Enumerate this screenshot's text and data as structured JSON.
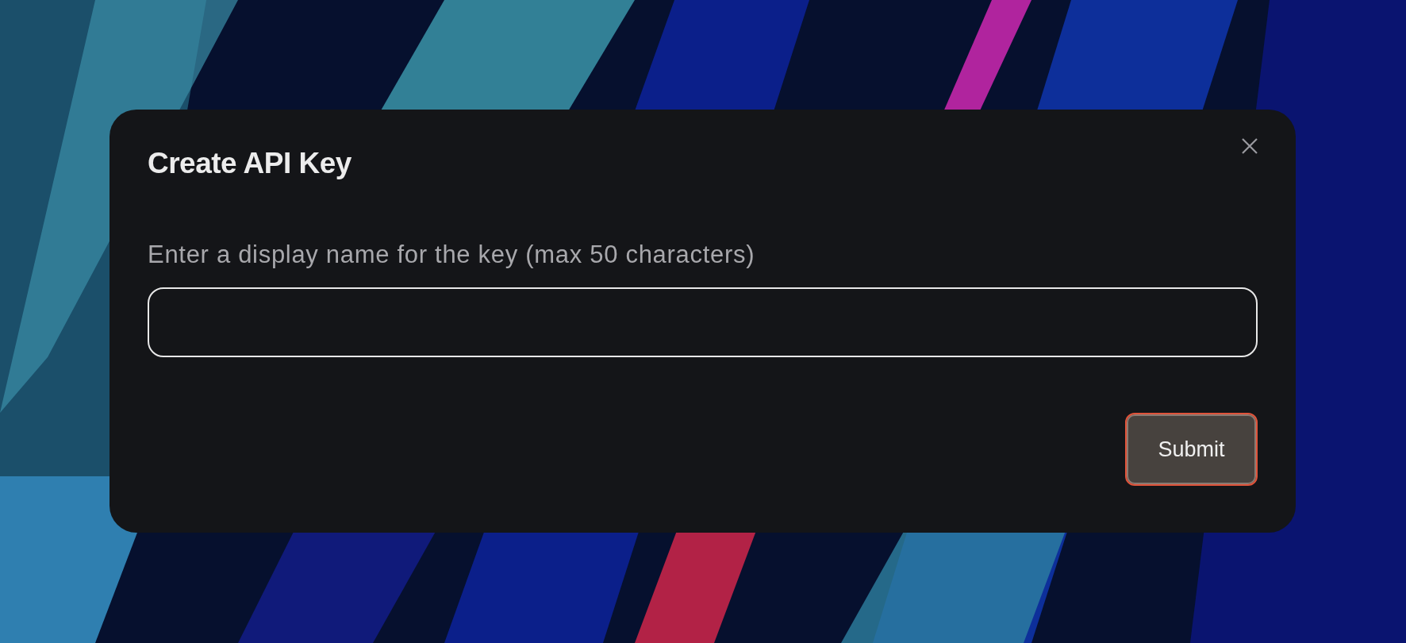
{
  "dialog": {
    "title": "Create API Key",
    "field": {
      "label": "Enter a display name for the key (max 50 characters)"
    },
    "buttons": [
      {
        "label": "Submit",
        "kind": "primary"
      }
    ]
  }
}
